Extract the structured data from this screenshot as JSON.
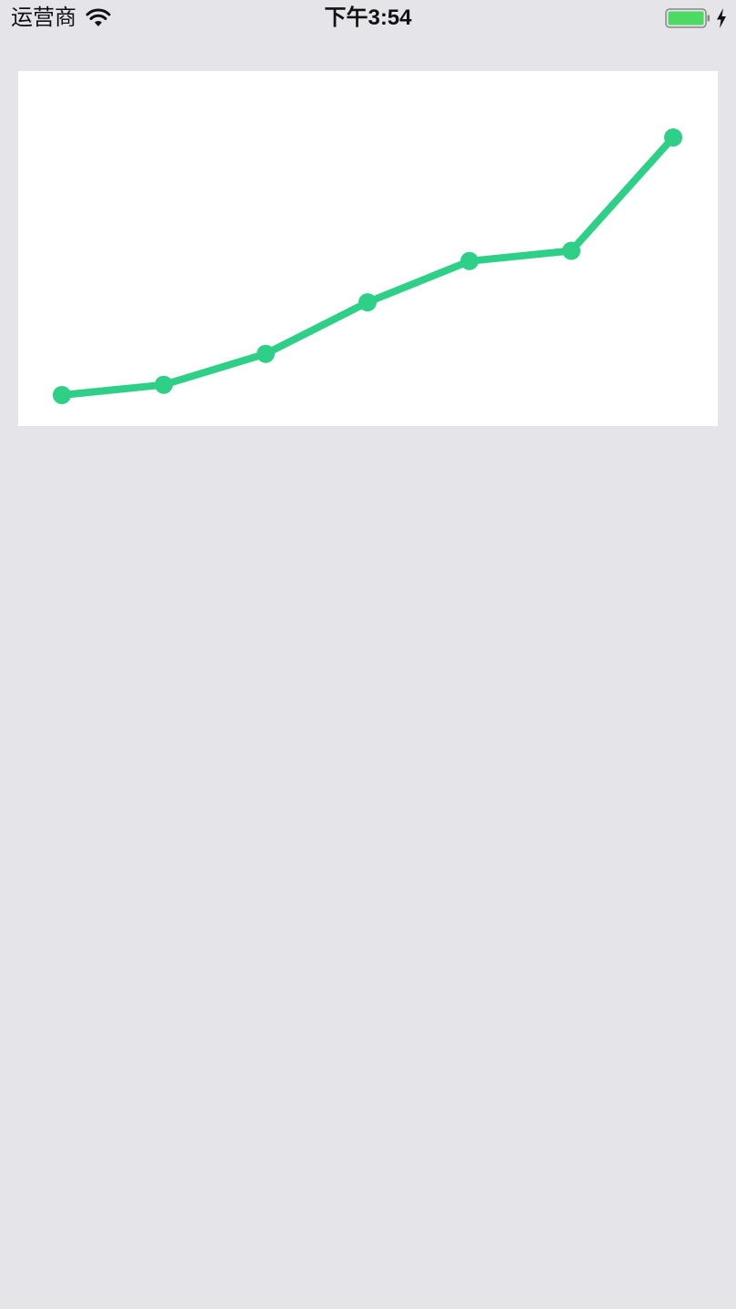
{
  "status_bar": {
    "carrier": "运营商",
    "time": "下午3:54",
    "wifi_icon": "wifi-icon",
    "battery_icon": "battery-icon",
    "charging_icon": "charging-bolt-icon",
    "battery_color": "#4cd964"
  },
  "chart_data": {
    "type": "line",
    "x": [
      1,
      2,
      3,
      4,
      5,
      6,
      7
    ],
    "series": [
      {
        "values": [
          12,
          16,
          28,
          48,
          64,
          68,
          112
        ],
        "color": "#2ecf86"
      }
    ],
    "ylim": [
      0,
      124
    ],
    "grid": false,
    "axes_visible": false,
    "markers": true
  }
}
